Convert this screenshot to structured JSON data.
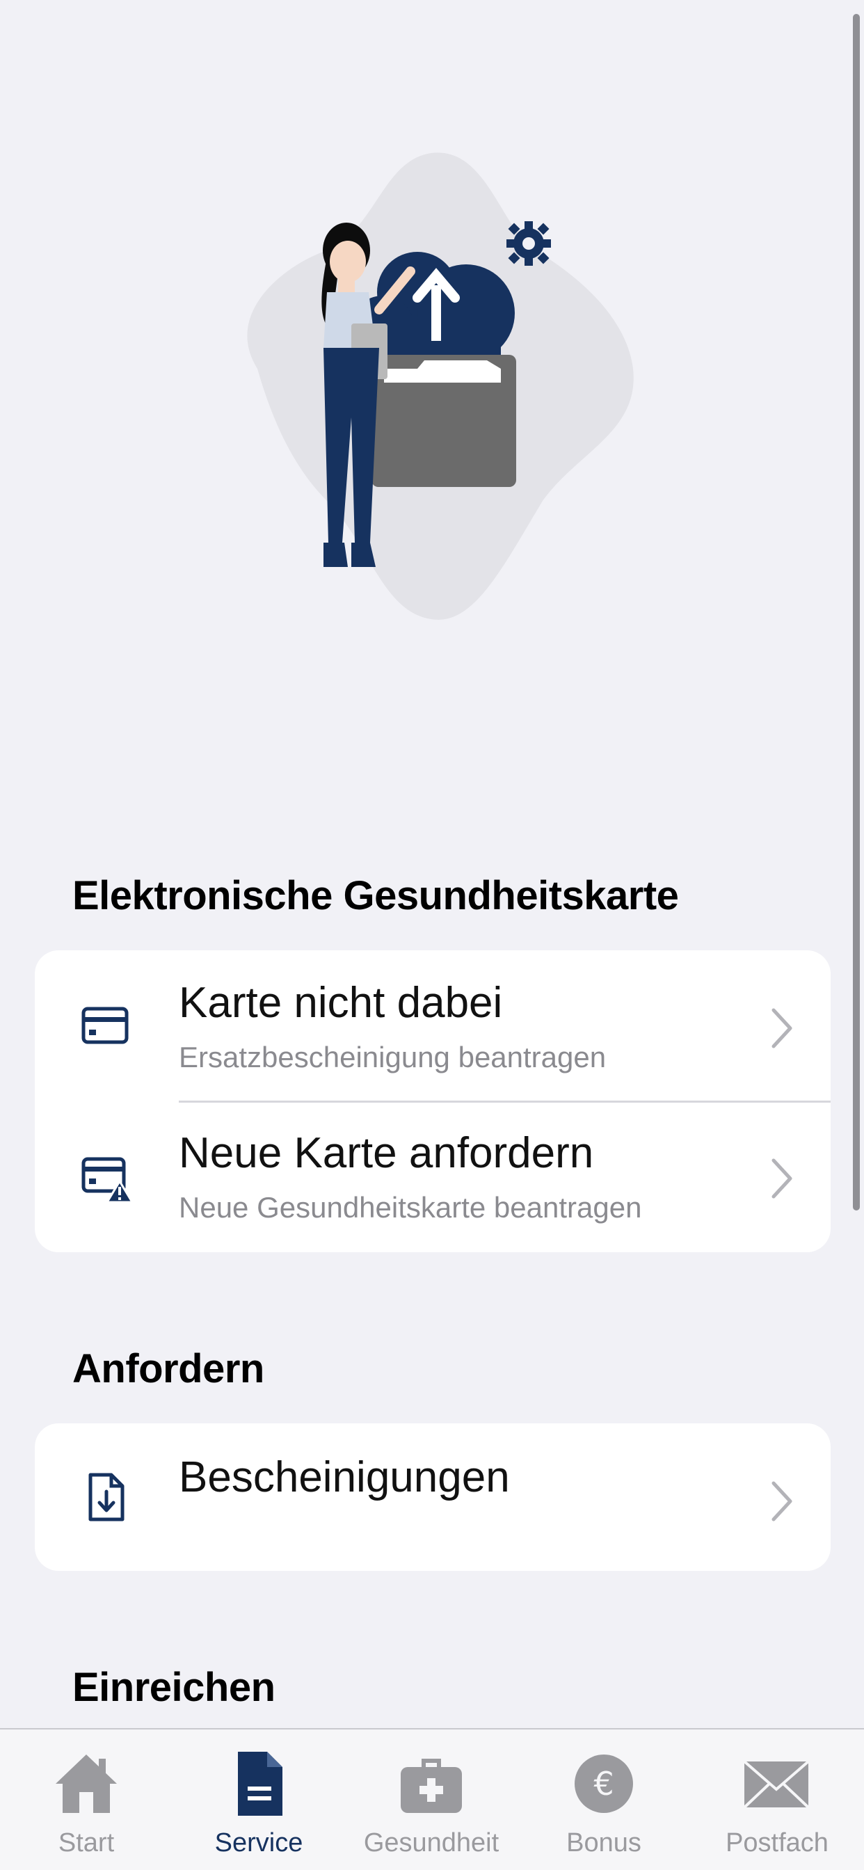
{
  "sections": [
    {
      "title": "Elektronische Gesundheitskarte",
      "items": [
        {
          "title": "Karte nicht dabei",
          "subtitle": "Ersatzbescheinigung beantragen",
          "icon": "card-icon"
        },
        {
          "title": "Neue Karte anfordern",
          "subtitle": "Neue Gesundheitskarte beantragen",
          "icon": "card-warning-icon"
        }
      ]
    },
    {
      "title": "Anfordern",
      "items": [
        {
          "title": "Bescheinigungen",
          "icon": "document-download-icon"
        }
      ]
    },
    {
      "title": "Einreichen",
      "items": []
    }
  ],
  "tabbar": {
    "active": "Service",
    "tabs": [
      {
        "label": "Start",
        "icon": "home-icon"
      },
      {
        "label": "Service",
        "icon": "document-icon"
      },
      {
        "label": "Gesundheit",
        "icon": "medical-bag-icon"
      },
      {
        "label": "Bonus",
        "icon": "euro-icon"
      },
      {
        "label": "Postfach",
        "icon": "mail-icon"
      }
    ]
  },
  "colors": {
    "background": "#f1f1f6",
    "primary": "#16325f",
    "inactive": "#9a9a9e",
    "card": "#ffffff"
  }
}
